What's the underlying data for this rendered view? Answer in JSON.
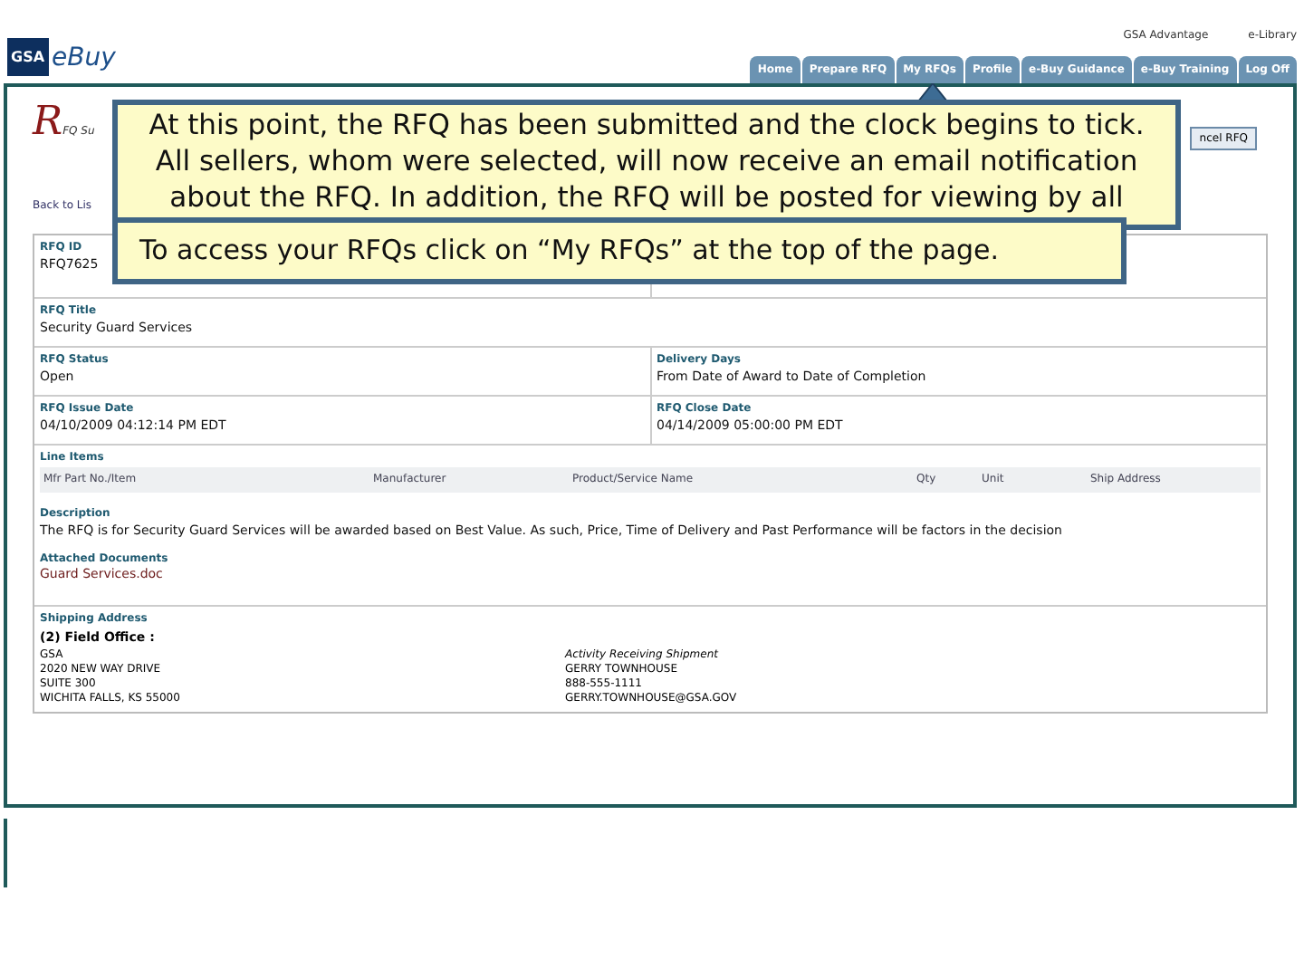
{
  "header": {
    "logo_badge": "GSA",
    "logo_text": "eBuy",
    "links": [
      "GSA Advantage",
      "e-Library"
    ],
    "tabs": [
      "Home",
      "Prepare RFQ",
      "My RFQs",
      "Profile",
      "e-Buy Guidance",
      "e-Buy Training",
      "Log Off"
    ]
  },
  "page": {
    "title_initial": "R",
    "title_rest": "FQ Su",
    "cancel_button": "ncel RFQ",
    "back_link": "Back to Lis",
    "rows": [
      {
        "cells": [
          {
            "label": "RFQ ID",
            "value": "RFQ7625"
          },
          {}
        ]
      },
      {
        "cells": [
          {
            "label": "RFQ Title",
            "value": "Security Guard Services"
          }
        ]
      },
      {
        "cells": [
          {
            "label": "RFQ Status",
            "value": "Open"
          },
          {
            "label": "Delivery Days",
            "value": "From Date of Award to Date of Completion"
          }
        ]
      },
      {
        "cells": [
          {
            "label": "RFQ Issue Date",
            "value": "04/10/2009 04:12:14 PM EDT"
          },
          {
            "label": "RFQ Close Date",
            "value": "04/14/2009 05:00:00 PM EDT"
          }
        ]
      }
    ],
    "line_items": {
      "label": "Line Items",
      "columns": [
        "Mfr Part No./Item",
        "Manufacturer",
        "Product/Service Name",
        "Qty",
        "Unit",
        "Ship Address"
      ]
    },
    "description": {
      "label": "Description",
      "text": "The RFQ is for Security Guard Services will be awarded based on Best Value. As such, Price, Time of Delivery and Past Performance will be factors in the decision"
    },
    "attachments": {
      "label": "Attached Documents",
      "files": [
        "Guard Services.doc"
      ]
    },
    "shipping": {
      "label": "Shipping Address",
      "office": "(2) Field Office :",
      "address": [
        "GSA",
        "2020 NEW WAY DRIVE",
        "SUITE 300",
        "WICHITA FALLS, KS 55000"
      ],
      "contact_title": "Activity Receiving Shipment",
      "contact": [
        "GERRY TOWNHOUSE",
        "888-555-1111",
        "GERRY.TOWNHOUSE@GSA.GOV"
      ]
    }
  },
  "callouts": [
    {
      "text": "At this point, the RFQ has been submitted and the clock begins to tick. All sellers, whom were selected, will now receive an email notification about the RFQ.  In addition, the RFQ will be posted for viewing by all"
    },
    {
      "text": "To access your RFQs click on “My RFQs”  at the top of the page."
    }
  ]
}
